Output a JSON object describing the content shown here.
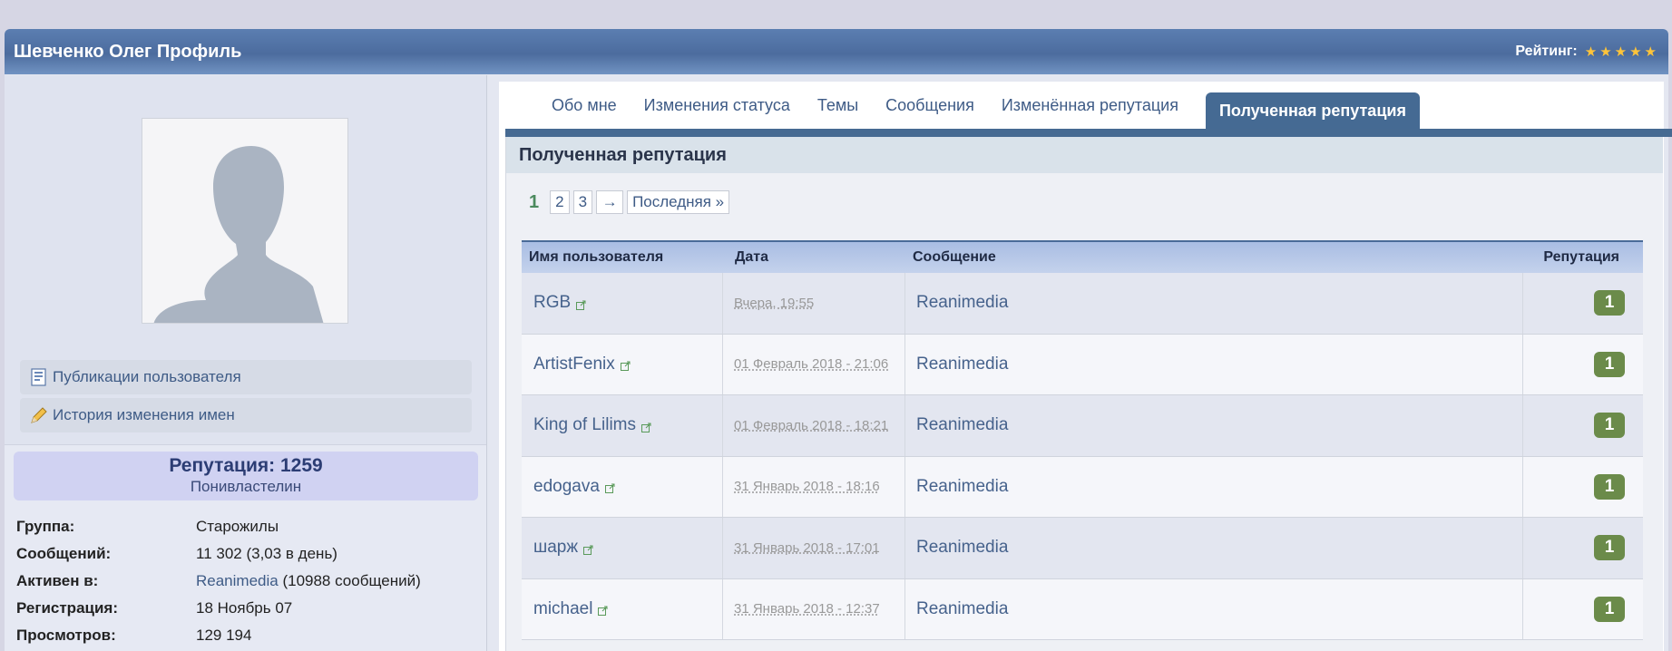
{
  "header": {
    "title": "Шевченко Олег Профиль",
    "rating_label": "Рейтинг:",
    "stars": "★★★★★"
  },
  "sidebar": {
    "links": [
      {
        "label": "Публикации пользователя",
        "icon": "document-icon"
      },
      {
        "label": "История изменения имен",
        "icon": "pencil-icon"
      }
    ],
    "reputation": {
      "title": "Репутация: 1259",
      "rank": "Понивластелин"
    },
    "info": [
      {
        "label": "Группа:",
        "value": "Старожилы"
      },
      {
        "label": "Сообщений:",
        "value": "11 302 (3,03 в день)"
      },
      {
        "label": "Активен в:",
        "link": "Reanimedia",
        "value": " (10988 сообщений)"
      },
      {
        "label": "Регистрация:",
        "value": "18 Ноябрь 07"
      },
      {
        "label": "Просмотров:",
        "value": "129 194"
      }
    ]
  },
  "tabs": [
    {
      "label": "Обо мне"
    },
    {
      "label": "Изменения статуса"
    },
    {
      "label": "Темы"
    },
    {
      "label": "Сообщения"
    },
    {
      "label": "Изменённая репутация"
    },
    {
      "label": "Полученная репутация",
      "active": true
    }
  ],
  "section": {
    "title": "Полученная репутация",
    "pager": {
      "current": "1",
      "pages": [
        "2",
        "3"
      ],
      "next": "→",
      "last": "Последняя »"
    }
  },
  "table": {
    "columns": [
      "Имя пользователя",
      "Дата",
      "Сообщение",
      "Репутация"
    ],
    "rows": [
      {
        "user": "RGB",
        "date": "Вчера, 19:55",
        "message": "Reanimedia",
        "rep": "1"
      },
      {
        "user": "ArtistFenix",
        "date": "01 Февраль 2018 - 21:06",
        "message": "Reanimedia",
        "rep": "1"
      },
      {
        "user": "King of Lilims",
        "date": "01 Февраль 2018 - 18:21",
        "message": "Reanimedia",
        "rep": "1"
      },
      {
        "user": "edogava",
        "date": "31 Январь 2018 - 18:16",
        "message": "Reanimedia",
        "rep": "1"
      },
      {
        "user": "шарж",
        "date": "31 Январь 2018 - 17:01",
        "message": "Reanimedia",
        "rep": "1"
      },
      {
        "user": "michael",
        "date": "31 Январь 2018 - 12:37",
        "message": "Reanimedia",
        "rep": "1"
      }
    ]
  },
  "colors": {
    "header_bar": "#4c6c9e",
    "tab_active": "#456a93",
    "badge": "#6b8b4a",
    "link": "#46628c",
    "star": "#ffc43a"
  }
}
